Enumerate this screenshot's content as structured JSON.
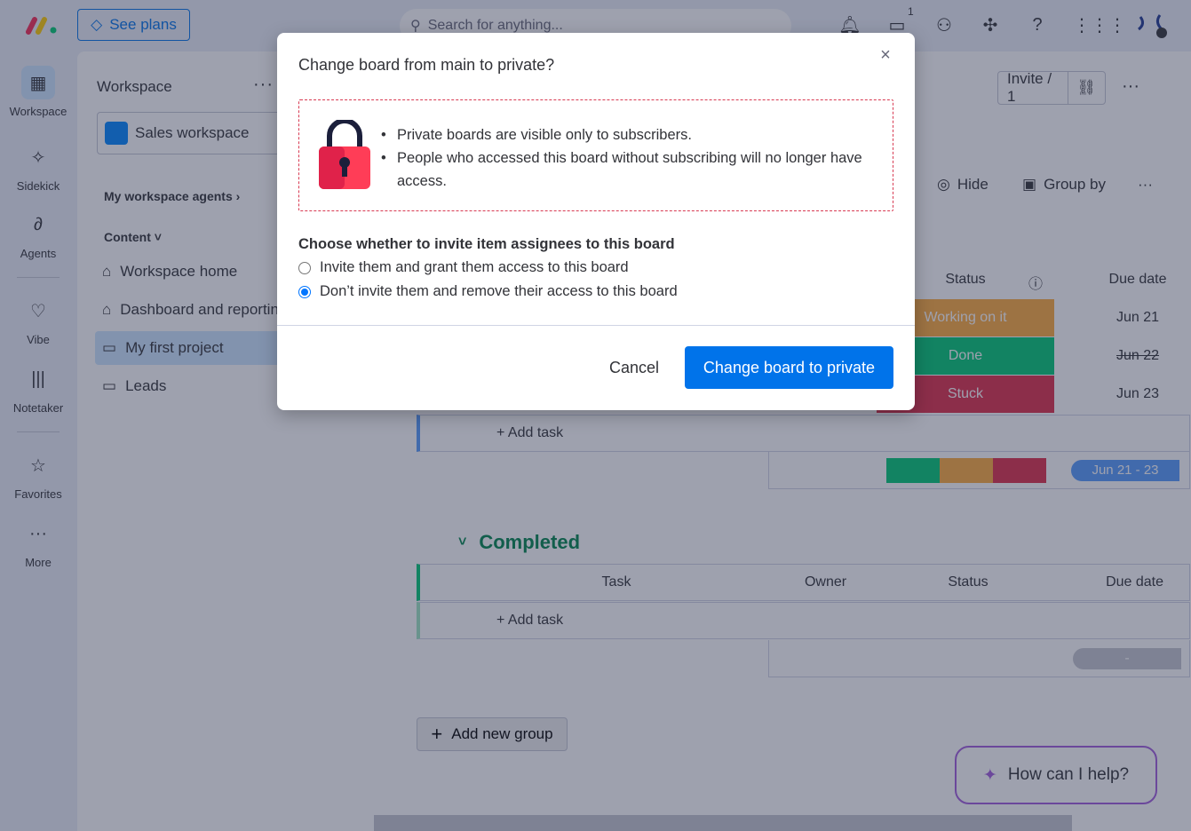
{
  "topbar": {
    "see_plans": "See plans",
    "search_placeholder": "Search for anything...",
    "inbox_count": "1"
  },
  "rail": {
    "items": [
      {
        "label": "Workspace",
        "icon": "grid-icon"
      },
      {
        "label": "Sidekick",
        "icon": "sparkle-icon"
      },
      {
        "label": "Agents",
        "icon": "agents-icon"
      },
      {
        "label": "Vibe",
        "icon": "heart-icon"
      },
      {
        "label": "Notetaker",
        "icon": "waveform-icon"
      },
      {
        "label": "Favorites",
        "icon": "star-icon"
      },
      {
        "label": "More",
        "icon": "more-icon"
      }
    ]
  },
  "sidebar": {
    "title": "Workspace",
    "workspace_name": "Sales workspace",
    "agents_section": "My workspace agents",
    "content_section": "Content",
    "items": [
      {
        "label": "Workspace home"
      },
      {
        "label": "Dashboard and reporting"
      },
      {
        "label": "My first project"
      },
      {
        "label": "Leads"
      }
    ]
  },
  "board": {
    "invite_label": "Invite / 1",
    "hide_label": "Hide",
    "group_by_label": "Group by",
    "columns": {
      "status": "Status",
      "due_date": "Due date",
      "task": "Task",
      "owner": "Owner"
    },
    "rows": [
      {
        "status": "Working on it",
        "status_color": "#fdab3d",
        "date": "Jun 21"
      },
      {
        "status": "Done",
        "status_color": "#00c875",
        "date": "Jun 22"
      },
      {
        "status": "Stuck",
        "status_color": "#df2f4a",
        "date": "Jun 23"
      }
    ],
    "add_task": "+ Add task",
    "date_range": "Jun 21 - 23",
    "completed_group": "Completed",
    "empty_range": "-",
    "add_new_group": "Add new group",
    "help": "How can I help?"
  },
  "modal": {
    "title": "Change board from main to private?",
    "bullets": [
      "Private boards are visible only to subscribers.",
      "People who accessed this board without subscribing will no longer have access."
    ],
    "choose_label": "Choose whether to invite item assignees to this board",
    "option_invite": "Invite them and grant them access to this board",
    "option_dont_invite": "Don’t invite them and remove their access to this board",
    "cancel": "Cancel",
    "confirm": "Change board to private"
  },
  "colors": {
    "accent": "#0073ea",
    "danger_border": "#d83a52",
    "lock": "#ff3d57"
  }
}
